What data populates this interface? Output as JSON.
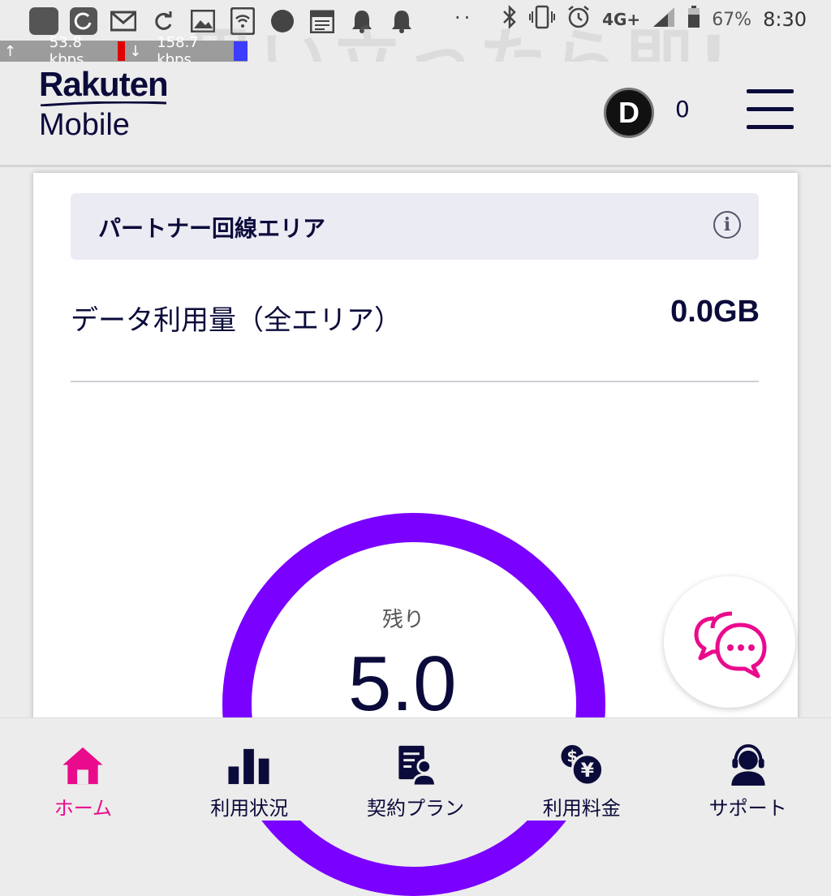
{
  "status_bar": {
    "icons": [
      "app-icon",
      "sync-app-icon",
      "gmail-icon",
      "refresh-icon",
      "image-icon",
      "wifi-icon",
      "record-icon",
      "calendar-icon",
      "bell-icon",
      "bell-icon"
    ],
    "dots": "··",
    "right_icons": [
      "bluetooth-icon",
      "vibrate-icon",
      "alarm-icon",
      "signal-icon"
    ],
    "network_type": "4G+",
    "battery": "67%",
    "time": "8:30"
  },
  "net_speed": {
    "up": "53.8 kbps",
    "down": "158.7 kbps"
  },
  "overlay": "思い立ったら即!",
  "header": {
    "logo_line1": "Rakuten",
    "logo_line2": "Mobile",
    "avatar_letter": "D",
    "points": "0"
  },
  "card": {
    "area_title": "パートナー回線エリア",
    "usage_label": "データ利用量（全エリア）",
    "usage_value": "0.0GB",
    "remain_label": "残り",
    "remain_value": "5.0"
  },
  "colors": {
    "accent": "#ea0b8c",
    "gauge": "#7a00ff",
    "navy": "#0b0b3b"
  },
  "bottom_nav": {
    "items": [
      {
        "label": "ホーム",
        "icon": "home-icon",
        "active": true
      },
      {
        "label": "利用状況",
        "icon": "bar-chart-icon",
        "active": false
      },
      {
        "label": "契約プラン",
        "icon": "contract-icon",
        "active": false
      },
      {
        "label": "利用料金",
        "icon": "fee-icon",
        "active": false
      },
      {
        "label": "サポート",
        "icon": "support-icon",
        "active": false
      }
    ]
  }
}
